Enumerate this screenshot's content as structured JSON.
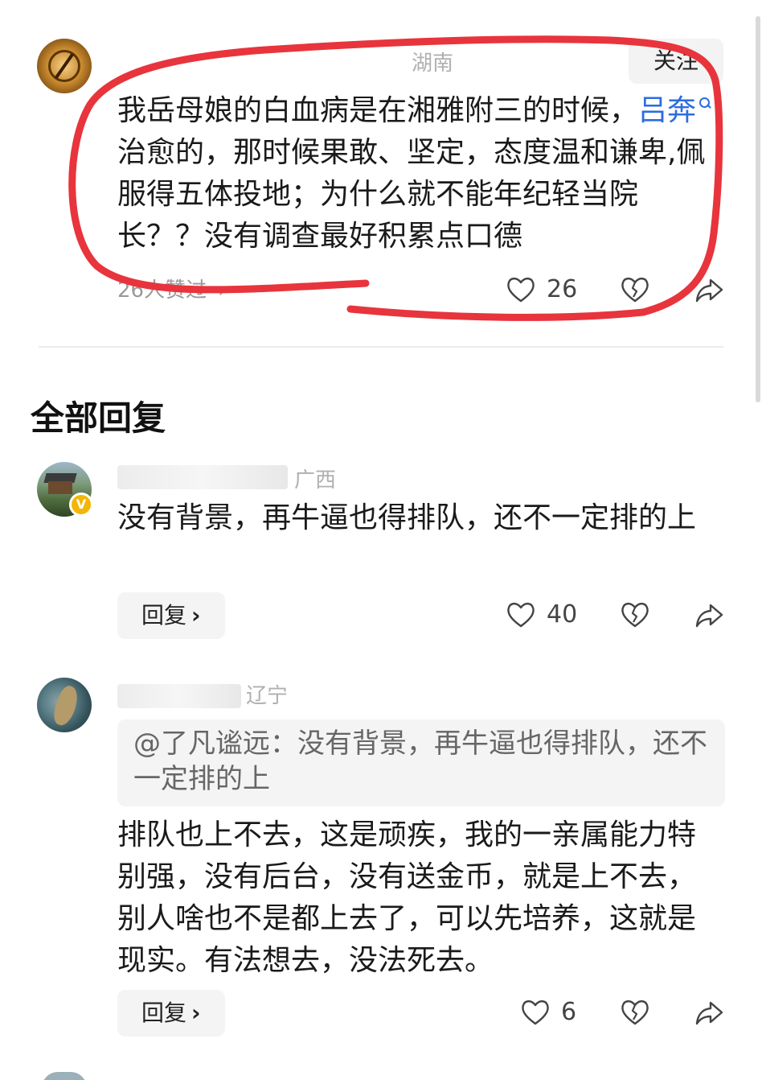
{
  "main_comment": {
    "region": "湖南",
    "follow_label": "关注",
    "text_part1": "我岳母娘的白血病是在湘雅附三的时候，",
    "link_text": "吕奔",
    "text_part2": "治愈的，那时候果敢、坚定，态度温和谦卑,佩服得五体投地；为什么就不能年纪轻当院长？？没有调查最好积累点口德",
    "likers_text": "26人赞过",
    "likers_chevron": "›",
    "like_count": "26"
  },
  "section_title": "全部回复",
  "replies": [
    {
      "region": "广西",
      "badge": "V",
      "text": "没有背景，再牛逼也得排队，还不一定排的上",
      "reply_label": "回复",
      "reply_chevron": "›",
      "like_count": "40"
    },
    {
      "region": "辽宁",
      "quote": "@了凡谧远：没有背景，再牛逼也得排队，还不一定排的上",
      "text": "排队也上不去，这是顽疾，我的一亲属能力特别强，没有后台，没有送金币，就是上不去，别人啥也不是都上去了，可以先培养，这就是现实。有法想去，没法死去。",
      "reply_label": "回复",
      "reply_chevron": "›",
      "like_count": "6"
    }
  ],
  "icons": {
    "like": "heart-icon",
    "dislike": "broken-heart-icon",
    "share": "share-icon",
    "search": "search-icon"
  },
  "colors": {
    "link": "#2b6de0",
    "annotation": "#e8343c",
    "badge": "#f2b705"
  }
}
